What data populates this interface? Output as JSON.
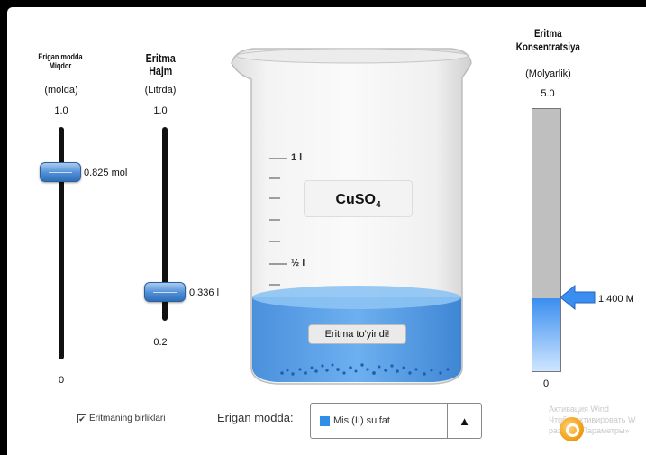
{
  "solute_slider": {
    "title_line1": "Erigan modda",
    "title_line2": "Miqdor",
    "unit": "(molda)",
    "max": "1.0",
    "min": "0",
    "value_label": "0.825 mol",
    "value": 0.825
  },
  "volume_slider": {
    "title_line1": "Eritma",
    "title_line2": "Hajm",
    "unit": "(Litrda)",
    "max": "1.0",
    "min": "0.2",
    "value_label": "0.336 l",
    "value": 0.336
  },
  "beaker": {
    "formula": "CuSO",
    "formula_sub": "4",
    "mark_1": "1 l",
    "mark_half": "½ l",
    "saturated_label": "Eritma to'yindi!",
    "solution_color": "#5ba3ea"
  },
  "concentration_meter": {
    "title_line1": "Eritma",
    "title_line2": "Konsentratsiya",
    "unit": "(Molyarlik)",
    "max": "5.0",
    "min": "0",
    "value_label": "1.400 M",
    "value": 1.4,
    "max_value": 5.0
  },
  "controls": {
    "show_values_checked": true,
    "show_values_label": "Eritmaning birliklari",
    "solute_label": "Erigan modda:",
    "solute_value": "Mis (II) sulfat",
    "solute_color": "#2f8fe8"
  },
  "watermark": {
    "line1": "Активация Wind",
    "line2": "Чтобы активировать W",
    "line3": "раздел «Параметры»"
  }
}
